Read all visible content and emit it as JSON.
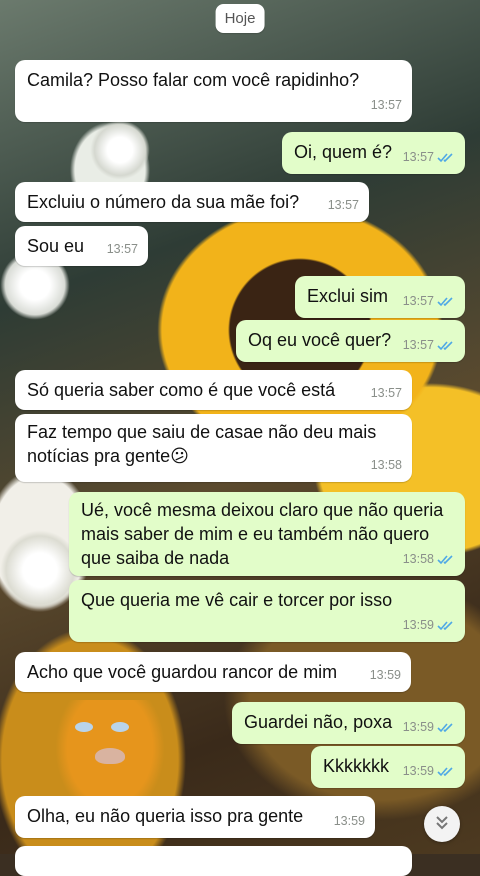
{
  "date_chip": "Hoje",
  "colors": {
    "incoming_bubble": "#ffffff",
    "outgoing_bubble": "#e2fdc9",
    "read_ticks": "#4fa8e6"
  },
  "icons": {
    "read_receipt": "double-check-icon",
    "scroll_down": "chevrons-down-icon"
  },
  "messages": [
    {
      "dir": "in",
      "text": "Camila? Posso falar com você rapidinho?",
      "time": "13:57"
    },
    {
      "dir": "out",
      "text": "Oi, quem é?",
      "time": "13:57"
    },
    {
      "dir": "in",
      "text": "Excluiu o número da sua mãe foi?",
      "time": "13:57"
    },
    {
      "dir": "in",
      "text": "Sou eu",
      "time": "13:57"
    },
    {
      "dir": "out",
      "text": "Exclui sim",
      "time": "13:57"
    },
    {
      "dir": "out",
      "text": "Oq eu você quer?",
      "time": "13:57"
    },
    {
      "dir": "in",
      "text": "Só queria saber como é que você está",
      "time": "13:57"
    },
    {
      "dir": "in",
      "text": "Faz tempo que saiu de casae não deu mais notícias pra gente😕",
      "time": "13:58"
    },
    {
      "dir": "out",
      "text": "Ué, você mesma deixou claro que não queria mais saber de mim e eu também não quero que saiba de nada",
      "time": "13:58"
    },
    {
      "dir": "out",
      "text": "Que queria me vê cair e torcer por isso",
      "time": "13:59"
    },
    {
      "dir": "in",
      "text": "Acho que você guardou rancor de mim",
      "time": "13:59"
    },
    {
      "dir": "out",
      "text": "Guardei não, poxa",
      "time": "13:59"
    },
    {
      "dir": "out",
      "text": "Kkkkkkk",
      "time": "13:59"
    },
    {
      "dir": "in",
      "text": "Olha, eu não queria isso pra gente",
      "time": "13:59"
    }
  ]
}
